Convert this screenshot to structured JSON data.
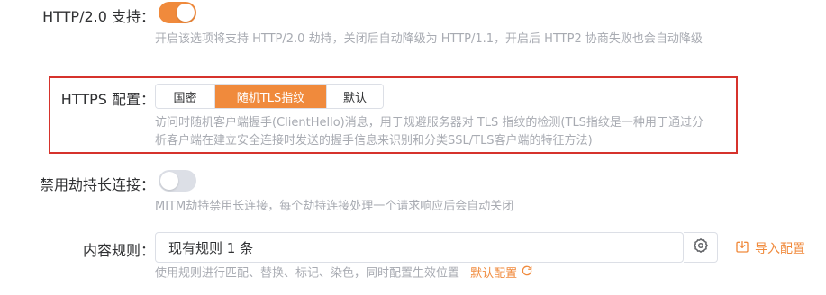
{
  "http2": {
    "label": "HTTP/2.0 支持：",
    "enabled": true,
    "help": "开启该选项将支持 HTTP/2.0 劫持，关闭后自动降级为 HTTP/1.1，开启后 HTTP2 协商失败也会自动降级"
  },
  "https": {
    "label": "HTTPS 配置：",
    "options": [
      "国密",
      "随机TLS指纹",
      "默认"
    ],
    "selected": "随机TLS指纹",
    "help": "访问时随机客户端握手(ClientHello)消息，用于规避服务器对 TLS 指纹的检测(TLS指纹是一种用于通过分析客户端在建立安全连接时发送的握手信息来识别和分类SSL/TLS客户端的特征方法)"
  },
  "keepalive": {
    "label": "禁用劫持长连接：",
    "enabled": false,
    "help": "MITM劫持禁用长连接，每个劫持连接处理一个请求响应后会自动关闭"
  },
  "rules": {
    "label": "内容规则：",
    "value": "现有规则 1 条",
    "help": "使用规则进行匹配、替换、标记、染色，同时配置生效位置",
    "default_link": "默认配置",
    "import_label": "导入配置"
  },
  "colors": {
    "accent": "#f08a3c",
    "highlight_border": "#d6332c",
    "switch_off": "#dcdfe6"
  },
  "icons": [
    "refresh-icon",
    "gear-icon",
    "import-icon"
  ]
}
